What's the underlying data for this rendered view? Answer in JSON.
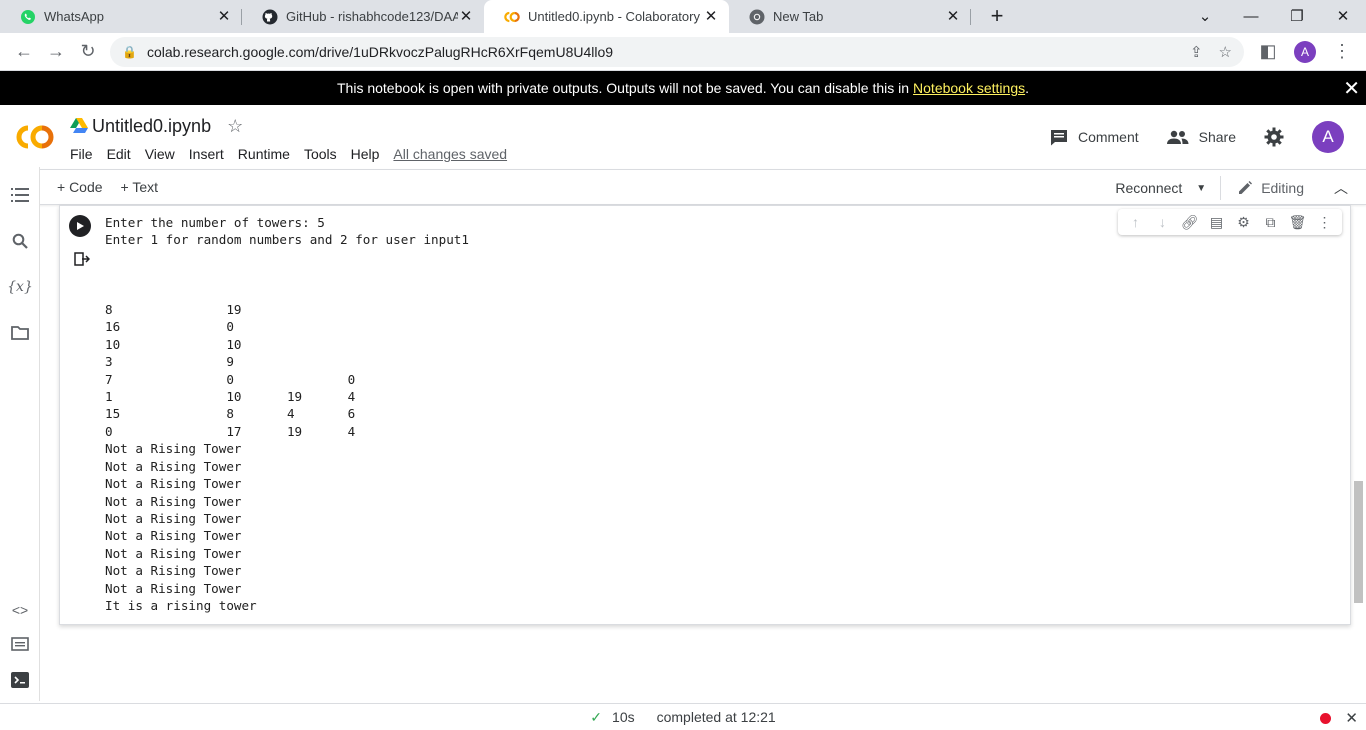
{
  "browser": {
    "tabs": [
      {
        "title": "WhatsApp",
        "icon": "whatsapp-icon",
        "active": false
      },
      {
        "title": "GitHub - rishabhcode123/DAA-",
        "icon": "github-icon",
        "active": false
      },
      {
        "title": "Untitled0.ipynb - Colaboratory",
        "icon": "colab-icon",
        "active": true
      },
      {
        "title": "New Tab",
        "icon": "chrome-icon",
        "active": false
      }
    ],
    "url": "colab.research.google.com/drive/1uDRkvoczPalugRHcR6XrFqemU8U4llo9",
    "profile_initial": "A"
  },
  "banner": {
    "text": "This notebook is open with private outputs. Outputs will not be saved. You can disable this in",
    "link": "Notebook settings",
    "suffix": "."
  },
  "colab": {
    "doc_title": "Untitled0.ipynb",
    "menu": [
      "File",
      "Edit",
      "View",
      "Insert",
      "Runtime",
      "Tools",
      "Help"
    ],
    "saved_status": "All changes saved",
    "comment_label": "Comment",
    "share_label": "Share",
    "profile_initial": "A"
  },
  "toolbar": {
    "add_code": "+ Code",
    "add_text": "+ Text",
    "reconnect": "Reconnect",
    "editing": "Editing"
  },
  "cell": {
    "output_lines": [
      "Enter the number of towers: 5",
      "Enter 1 for random numbers and 2 for user input1",
      "",
      "",
      "",
      "8               19",
      "16              0",
      "10              10",
      "3               9",
      "7               0               0",
      "1               10      19      4",
      "15              8       4       6",
      "0               17      19      4",
      "Not a Rising Tower",
      "Not a Rising Tower",
      "Not a Rising Tower",
      "Not a Rising Tower",
      "Not a Rising Tower",
      "Not a Rising Tower",
      "Not a Rising Tower",
      "Not a Rising Tower",
      "Not a Rising Tower",
      "It is a rising tower"
    ]
  },
  "status": {
    "elapsed": "10s",
    "completed": "completed at 12:21"
  },
  "colors": {
    "accent_orange": "#f9ab00",
    "avatar_purple": "#7b3fbf",
    "banner_link": "#fef15f"
  }
}
